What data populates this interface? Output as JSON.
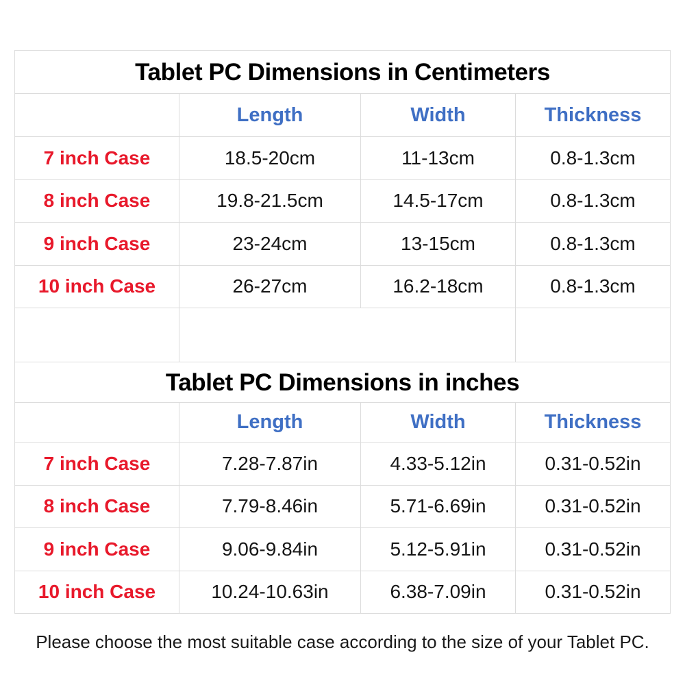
{
  "page": {
    "background_color": "#ffffff",
    "border_color": "#dcdcdc",
    "accent_red": "#e8192b",
    "accent_blue": "#3f6fc4",
    "text_color": "#161616"
  },
  "tables": [
    {
      "title": "Tablet PC Dimensions in Centimeters",
      "headers": [
        "",
        "Length",
        "Width",
        "Thickness"
      ],
      "rows": [
        {
          "case": "7 inch Case",
          "length": "18.5-20cm",
          "width": "11-13cm",
          "thickness": "0.8-1.3cm"
        },
        {
          "case": "8 inch Case",
          "length": "19.8-21.5cm",
          "width": "14.5-17cm",
          "thickness": "0.8-1.3cm"
        },
        {
          "case": "9 inch Case",
          "length": "23-24cm",
          "width": "13-15cm",
          "thickness": "0.8-1.3cm"
        },
        {
          "case": "10 inch Case",
          "length": "26-27cm",
          "width": "16.2-18cm",
          "thickness": "0.8-1.3cm"
        }
      ]
    },
    {
      "title": "Tablet PC Dimensions in inches",
      "headers": [
        "",
        "Length",
        "Width",
        "Thickness"
      ],
      "rows": [
        {
          "case": "7 inch Case",
          "length": "7.28-7.87in",
          "width": "4.33-5.12in",
          "thickness": "0.31-0.52in"
        },
        {
          "case": "8 inch Case",
          "length": "7.79-8.46in",
          "width": "5.71-6.69in",
          "thickness": "0.31-0.52in"
        },
        {
          "case": "9 inch Case",
          "length": "9.06-9.84in",
          "width": "5.12-5.91in",
          "thickness": "0.31-0.52in"
        },
        {
          "case": "10 inch Case",
          "length": "10.24-10.63in",
          "width": "6.38-7.09in",
          "thickness": "0.31-0.52in"
        }
      ]
    }
  ],
  "footer": {
    "note": "Please choose the most suitable case according to the size of your Tablet PC."
  },
  "chart_data": {
    "type": "table",
    "title": "Tablet PC case size reference chart",
    "tables": [
      {
        "title": "Tablet PC Dimensions in Centimeters",
        "unit": "cm",
        "columns": [
          "Case",
          "Length",
          "Width",
          "Thickness"
        ],
        "rows": [
          [
            "7 inch Case",
            "18.5-20cm",
            "11-13cm",
            "0.8-1.3cm"
          ],
          [
            "8 inch Case",
            "19.8-21.5cm",
            "14.5-17cm",
            "0.8-1.3cm"
          ],
          [
            "9 inch Case",
            "23-24cm",
            "13-15cm",
            "0.8-1.3cm"
          ],
          [
            "10 inch Case",
            "26-27cm",
            "16.2-18cm",
            "0.8-1.3cm"
          ]
        ]
      },
      {
        "title": "Tablet PC Dimensions in inches",
        "unit": "in",
        "columns": [
          "Case",
          "Length",
          "Width",
          "Thickness"
        ],
        "rows": [
          [
            "7 inch Case",
            "7.28-7.87in",
            "4.33-5.12in",
            "0.31-0.52in"
          ],
          [
            "8 inch Case",
            "7.79-8.46in",
            "5.71-6.69in",
            "0.31-0.52in"
          ],
          [
            "9 inch Case",
            "9.06-9.84in",
            "5.12-5.91in",
            "0.31-0.52in"
          ],
          [
            "10 inch Case",
            "10.24-10.63in",
            "6.38-7.09in",
            "0.31-0.52in"
          ]
        ]
      }
    ]
  }
}
